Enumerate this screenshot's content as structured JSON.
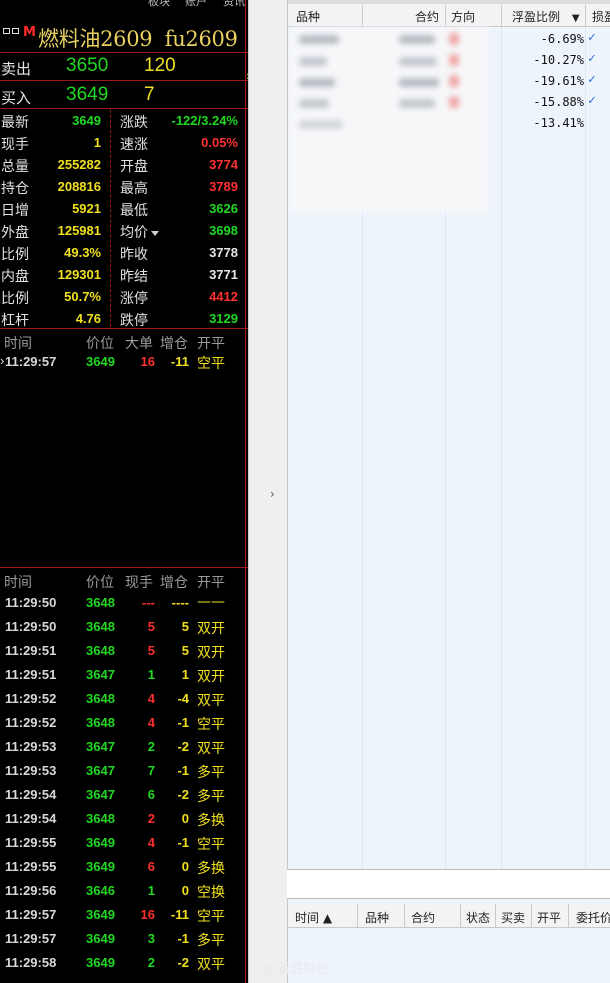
{
  "topnav": [
    "板块",
    "账户",
    "资讯"
  ],
  "instrument": {
    "badge": "M",
    "title": "燃料油2609",
    "code": "fu2609"
  },
  "orderbook": [
    {
      "label": "卖出",
      "price": "3650",
      "volume": "120"
    },
    {
      "label": "买入",
      "price": "3649",
      "volume": "7"
    }
  ],
  "quotes": [
    {
      "l1": "最新",
      "v1": "3649",
      "c1": "green",
      "l2": "涨跌",
      "v2": "-122/3.24%",
      "c2": "green"
    },
    {
      "l1": "现手",
      "v1": "1",
      "c1": "yellow",
      "l2": "速涨",
      "v2": "0.05%",
      "c2": "red"
    },
    {
      "l1": "总量",
      "v1": "255282",
      "c1": "yellow",
      "l2": "开盘",
      "v2": "3774",
      "c2": "red"
    },
    {
      "l1": "持仓",
      "v1": "208816",
      "c1": "yellow",
      "l2": "最高",
      "v2": "3789",
      "c2": "red"
    },
    {
      "l1": "日增",
      "v1": "5921",
      "c1": "yellow",
      "l2": "最低",
      "v2": "3626",
      "c2": "green"
    },
    {
      "l1": "外盘",
      "v1": "125981",
      "c1": "yellow",
      "l2": "均价",
      "v2": "3698",
      "c2": "green"
    },
    {
      "l1": "比例",
      "v1": "49.3%",
      "c1": "yellow",
      "l2": "昨收",
      "v2": "3778",
      "c2": "white"
    },
    {
      "l1": "内盘",
      "v1": "129301",
      "c1": "yellow",
      "l2": "昨结",
      "v2": "3771",
      "c2": "white"
    },
    {
      "l1": "比例",
      "v1": "50.7%",
      "c1": "yellow",
      "l2": "涨停",
      "v2": "4412",
      "c2": "red"
    },
    {
      "l1": "杠杆",
      "v1": "4.76",
      "c1": "yellow",
      "l2": "跌停",
      "v2": "3129",
      "c2": "green"
    }
  ],
  "big_orders": {
    "headers": [
      "时间",
      "价位",
      "大单",
      "增仓",
      "开平"
    ],
    "rows": [
      {
        "time": "11:29:57",
        "price": "3649",
        "vol": "16",
        "oi": "-11",
        "type": "空平"
      }
    ]
  },
  "ticks": {
    "headers": [
      "时间",
      "价位",
      "现手",
      "增仓",
      "开平"
    ],
    "rows": [
      {
        "time": "11:29:50",
        "price": "3648",
        "vol": "---",
        "vc": "red",
        "oi": "----",
        "type": "——"
      },
      {
        "time": "11:29:50",
        "price": "3648",
        "vol": "5",
        "vc": "red",
        "oi": "5",
        "type": "双开"
      },
      {
        "time": "11:29:51",
        "price": "3648",
        "vol": "5",
        "vc": "red",
        "oi": "5",
        "type": "双开"
      },
      {
        "time": "11:29:51",
        "price": "3647",
        "vol": "1",
        "vc": "green",
        "oi": "1",
        "type": "双开"
      },
      {
        "time": "11:29:52",
        "price": "3648",
        "vol": "4",
        "vc": "red",
        "oi": "-4",
        "type": "双平"
      },
      {
        "time": "11:29:52",
        "price": "3648",
        "vol": "4",
        "vc": "red",
        "oi": "-1",
        "type": "空平"
      },
      {
        "time": "11:29:53",
        "price": "3647",
        "vol": "2",
        "vc": "green",
        "oi": "-2",
        "type": "双平"
      },
      {
        "time": "11:29:53",
        "price": "3647",
        "vol": "7",
        "vc": "green",
        "oi": "-1",
        "type": "多平"
      },
      {
        "time": "11:29:54",
        "price": "3647",
        "vol": "6",
        "vc": "green",
        "oi": "-2",
        "type": "多平"
      },
      {
        "time": "11:29:54",
        "price": "3648",
        "vol": "2",
        "vc": "red",
        "oi": "0",
        "type": "多换"
      },
      {
        "time": "11:29:55",
        "price": "3649",
        "vol": "4",
        "vc": "red",
        "oi": "-1",
        "type": "空平"
      },
      {
        "time": "11:29:55",
        "price": "3649",
        "vol": "6",
        "vc": "red",
        "oi": "0",
        "type": "多换"
      },
      {
        "time": "11:29:56",
        "price": "3646",
        "vol": "1",
        "vc": "green",
        "oi": "0",
        "type": "空换"
      },
      {
        "time": "11:29:57",
        "price": "3649",
        "vol": "16",
        "vc": "red",
        "oi": "-11",
        "type": "空平"
      },
      {
        "time": "11:29:57",
        "price": "3649",
        "vol": "3",
        "vc": "green",
        "oi": "-1",
        "type": "多平"
      },
      {
        "time": "11:29:58",
        "price": "3649",
        "vol": "2",
        "vc": "green",
        "oi": "-2",
        "type": "双平"
      }
    ]
  },
  "positions": {
    "headers": [
      "品种",
      "合约",
      "方向",
      "浮盈比例",
      "损盈"
    ],
    "sort_arrow": "▼",
    "rows": [
      {
        "pct": "-6.69%",
        "check": "✓"
      },
      {
        "pct": "-10.27%",
        "check": "✓"
      },
      {
        "pct": "-19.61%",
        "check": "✓"
      },
      {
        "pct": "-15.88%",
        "check": "✓"
      },
      {
        "pct": "-13.41%",
        "check": ""
      }
    ]
  },
  "orders": {
    "headers": [
      "时间 ▲",
      "品种",
      "合约",
      "状态",
      "买卖",
      "开平",
      "委托价"
    ]
  },
  "splitter": {
    "chevron": "›"
  },
  "watermark": "@ 新浪财经",
  "colors": {
    "up": "#ff3030",
    "down": "#21d821",
    "neutral": "#f0e020",
    "grid_bg": "#eef4fc"
  }
}
